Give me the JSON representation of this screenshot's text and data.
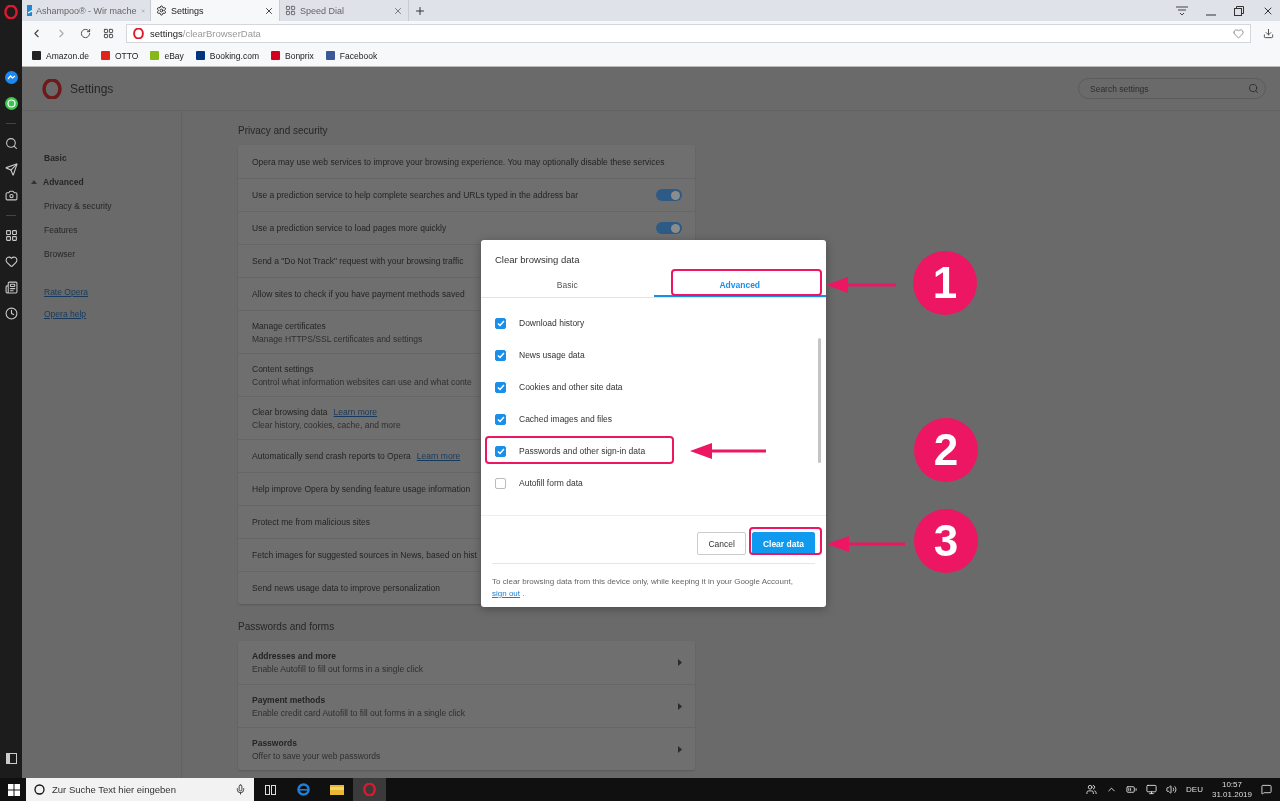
{
  "browser_tabs": [
    {
      "title": "Ashampoo® - Wir mache",
      "kind": "site",
      "selected": false
    },
    {
      "title": "Settings",
      "kind": "settings",
      "selected": true
    },
    {
      "title": "Speed Dial",
      "kind": "speed_dial",
      "selected": false
    }
  ],
  "address_bar": {
    "host": "settings",
    "path": "/clearBrowserData"
  },
  "bookmarks": [
    {
      "label": "Amazon.de",
      "color": "#222222"
    },
    {
      "label": "OTTO",
      "color": "#e2231a"
    },
    {
      "label": "eBay",
      "color": "#86b817"
    },
    {
      "label": "Booking.com",
      "color": "#003580"
    },
    {
      "label": "Bonprix",
      "color": "#d5001c"
    },
    {
      "label": "Facebook",
      "color": "#3b5998"
    }
  ],
  "settings": {
    "title": "Settings",
    "search_placeholder": "Search settings"
  },
  "nav": [
    {
      "label": "Basic",
      "kind": "section"
    },
    {
      "label": "Advanced",
      "kind": "section",
      "expanded": true
    },
    {
      "label": "Privacy & security",
      "kind": "item"
    },
    {
      "label": "Features",
      "kind": "item"
    },
    {
      "label": "Browser",
      "kind": "item"
    },
    {
      "label": "Rate Opera",
      "kind": "link"
    },
    {
      "label": "Opera help",
      "kind": "link"
    }
  ],
  "sections": [
    {
      "title": "Privacy and security",
      "rows": [
        {
          "kind": "text",
          "label": "Opera may use web services to improve your browsing experience. You may optionally disable these services"
        },
        {
          "kind": "toggle",
          "label": "Use a prediction service to help complete searches and URLs typed in the address bar",
          "on": true
        },
        {
          "kind": "toggle",
          "label": "Use a prediction service to load pages more quickly",
          "on": true
        },
        {
          "kind": "text",
          "label": "Send a \"Do Not Track\" request with your browsing traffic"
        },
        {
          "kind": "text",
          "label": "Allow sites to check if you have payment methods saved"
        },
        {
          "kind": "text",
          "label": "Manage certificates",
          "sublabel": "Manage HTTPS/SSL certificates and settings"
        },
        {
          "kind": "text",
          "label": "Content settings",
          "sublabel": "Control what information websites can use and what conte"
        },
        {
          "kind": "text",
          "label": "Clear browsing data",
          "link": "Learn more",
          "sublabel": "Clear history, cookies, cache, and more"
        },
        {
          "kind": "text",
          "label": "Automatically send crash reports to Opera",
          "link": "Learn more"
        },
        {
          "kind": "text",
          "label": "Help improve Opera by sending feature usage information"
        },
        {
          "kind": "text",
          "label": "Protect me from malicious sites"
        },
        {
          "kind": "text",
          "label": "Fetch images for suggested sources in News, based on hist"
        },
        {
          "kind": "text",
          "label": "Send news usage data to improve personalization"
        }
      ]
    },
    {
      "title": "Passwords and forms",
      "rows": [
        {
          "kind": "nav",
          "label": "Addresses and more",
          "sublabel": "Enable Autofill to fill out forms in a single click"
        },
        {
          "kind": "nav",
          "label": "Payment methods",
          "sublabel": "Enable credit card Autofill to fill out forms in a single click"
        },
        {
          "kind": "nav",
          "label": "Passwords",
          "sublabel": "Offer to save your web passwords"
        }
      ]
    }
  ],
  "dialog": {
    "title": "Clear browsing data",
    "tabs": [
      {
        "label": "Basic",
        "selected": false
      },
      {
        "label": "Advanced",
        "selected": true
      }
    ],
    "items": [
      {
        "label": "Download history",
        "checked": true
      },
      {
        "label": "News usage data",
        "checked": true
      },
      {
        "label": "Cookies and other site data",
        "checked": true
      },
      {
        "label": "Cached images and files",
        "checked": true
      },
      {
        "label": "Passwords and other sign-in data",
        "checked": true
      },
      {
        "label": "Autofill form data",
        "checked": false
      }
    ],
    "buttons": [
      {
        "label": "Cancel",
        "kind": "secondary"
      },
      {
        "label": "Clear data",
        "kind": "primary"
      }
    ],
    "footer": {
      "text": "To clear browsing data from this device only, while keeping it in your Google Account,",
      "link": "sign out",
      "end": "."
    }
  },
  "annotations": [
    {
      "number": "1"
    },
    {
      "number": "2"
    },
    {
      "number": "3"
    }
  ],
  "taskbar": {
    "search_placeholder": "Zur Suche Text hier eingeben",
    "language": "DEU",
    "time": "10:57",
    "date": "31.01.2019"
  }
}
